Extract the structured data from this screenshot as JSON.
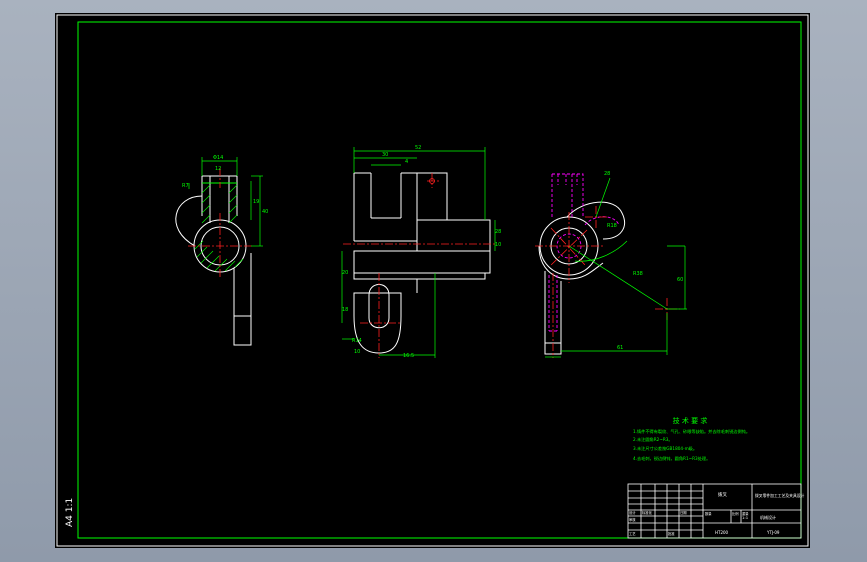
{
  "colors": {
    "frame": "#ffffff",
    "border": "#00ff00",
    "outline": "#ffffff",
    "dimension": "#00ff00",
    "centerline": "#ff2020",
    "hidden": "#ff00ff",
    "notes": "#00ff00",
    "title_block": "#ffffff"
  },
  "sheet": {
    "scale_label": "A4 1:1"
  },
  "views": {
    "left": {
      "dims": [
        "Φ14",
        "40",
        "R7",
        "19",
        "12"
      ]
    },
    "front": {
      "dims": [
        "52",
        "30",
        "4",
        "10",
        "20",
        "18",
        "R14",
        "10",
        "16.5",
        "28"
      ]
    },
    "right": {
      "dims": [
        "28",
        "R38",
        "R18",
        "60",
        "61"
      ]
    }
  },
  "notes": {
    "title": "技 术 要 求",
    "lines": [
      "1.铸件不得有裂纹、气孔、砂眼等缺陷。并去除毛刺锐边倒钝。",
      "2.未注圆角R2~R3。",
      "3.未注尺寸公差按GB1804-m级。",
      "4.去毛刺，锐边倒钝，圆角R1~R3处理。"
    ]
  },
  "title_block": {
    "part_name": "拨叉",
    "drawing_title": "拨叉零件加工工艺及夹具设计",
    "company": "机械设计",
    "drawing_no": "YTJ-09",
    "material": "HT200",
    "scale": "1:1",
    "ratio": "比例",
    "quantity": "数量",
    "weight": "重量",
    "designer": "设计",
    "checker": "审核",
    "approve": "批准",
    "process": "工艺",
    "standard": "标准化",
    "date": "日期"
  }
}
